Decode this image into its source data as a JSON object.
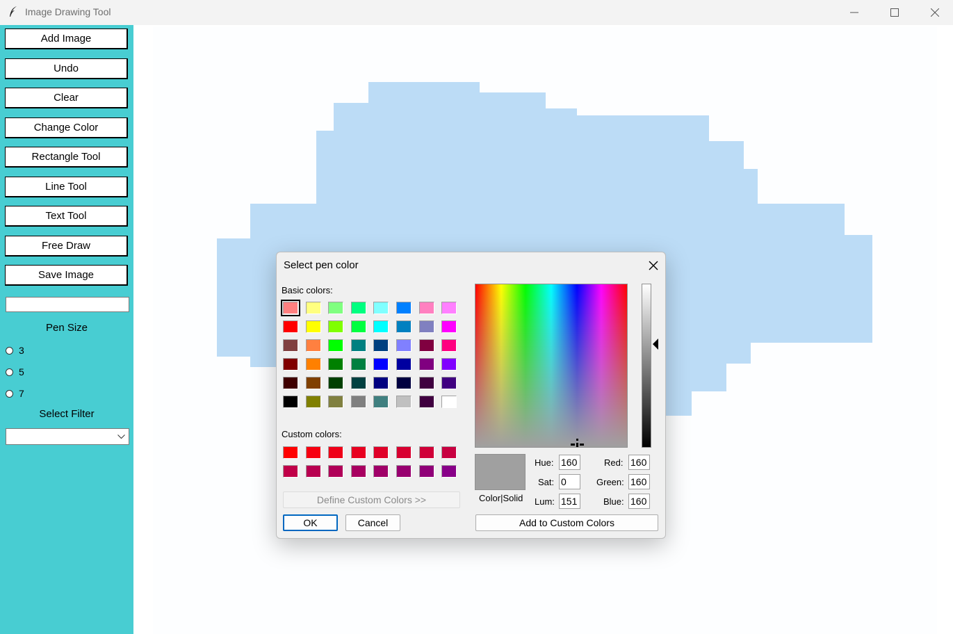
{
  "window": {
    "title": "Image Drawing Tool",
    "minimize": "—",
    "maximize": "☐",
    "close": "✕"
  },
  "sidebar": {
    "buttons": [
      "Add Image",
      "Undo",
      "Clear",
      "Change Color",
      "Rectangle Tool",
      "Line Tool",
      "Text Tool",
      "Free Draw",
      "Save Image"
    ],
    "text_input_value": "",
    "pen_size_label": "Pen Size",
    "pen_sizes": [
      "3",
      "5",
      "7"
    ],
    "filter_label": "Select Filter",
    "filter_selected": ""
  },
  "colors": {
    "sidebar_bg": "#48cdd2",
    "cloud": "#bcdcf6"
  },
  "dialog": {
    "title": "Select pen color",
    "basic_label": "Basic colors:",
    "custom_label": "Custom colors:",
    "define_custom": "Define Custom Colors >>",
    "ok": "OK",
    "cancel": "Cancel",
    "color_solid": "Color|Solid",
    "add_custom": "Add to Custom Colors",
    "fields": {
      "hue_label": "Hue:",
      "hue": "160",
      "sat_label": "Sat:",
      "sat": "0",
      "lum_label": "Lum:",
      "lum": "151",
      "red_label": "Red:",
      "red": "160",
      "green_label": "Green:",
      "green": "160",
      "blue_label": "Blue:",
      "blue": "160"
    },
    "basic_colors": [
      "#ff8080",
      "#ffff80",
      "#80ff80",
      "#00ff80",
      "#80ffff",
      "#0080ff",
      "#ff80c0",
      "#ff80ff",
      "#ff0000",
      "#ffff00",
      "#80ff00",
      "#00ff40",
      "#00ffff",
      "#0080c0",
      "#8080c0",
      "#ff00ff",
      "#804040",
      "#ff8040",
      "#00ff00",
      "#008080",
      "#004080",
      "#8080ff",
      "#800040",
      "#ff0080",
      "#800000",
      "#ff8000",
      "#008000",
      "#008040",
      "#0000ff",
      "#0000a0",
      "#800080",
      "#8000ff",
      "#400000",
      "#804000",
      "#004000",
      "#004040",
      "#000080",
      "#000040",
      "#400040",
      "#400080",
      "#000000",
      "#808000",
      "#808040",
      "#808080",
      "#408080",
      "#c0c0c0",
      "#400040",
      "#ffffff"
    ],
    "custom_colors": [
      "#ff0000",
      "#f70010",
      "#ef0018",
      "#e80020",
      "#e00028",
      "#d80030",
      "#d00038",
      "#c80040",
      "#c00048",
      "#b80050",
      "#b00058",
      "#a80060",
      "#a00068",
      "#980070",
      "#900078",
      "#880088"
    ]
  }
}
